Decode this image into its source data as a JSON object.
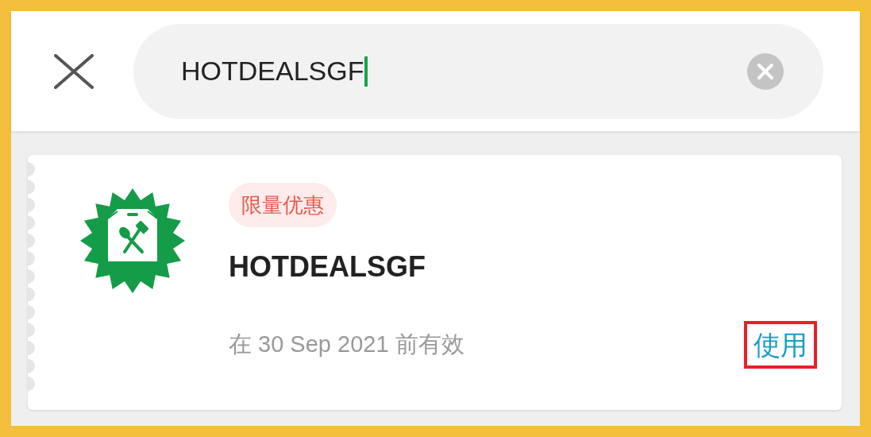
{
  "search": {
    "value": "HOTDEALSGF"
  },
  "voucher": {
    "badge": "限量优惠",
    "code": "HOTDEALSGF",
    "validity": "在 30 Sep 2021 前有效",
    "action": "使用"
  }
}
